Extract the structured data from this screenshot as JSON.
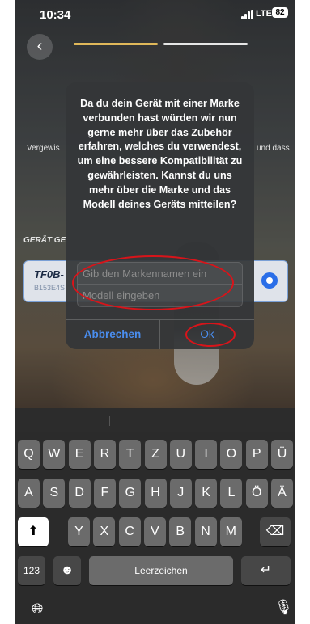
{
  "status_bar": {
    "time": "10:34",
    "network": "LTE",
    "battery": "82"
  },
  "background": {
    "side_text_left": "Vergewis",
    "side_text_right": "und dass",
    "device_section_label": "GERÄT GE",
    "device_name": "TF0B-",
    "device_id": "B153E4S"
  },
  "alert": {
    "message": "Da du dein Gerät mit einer Marke verbunden hast würden wir nun gerne mehr über das Zubehör erfahren, welches du verwendest, um eine bessere Kompatibilität zu gewährleisten. Kannst du uns mehr über die Marke und das Modell deines Geräts mitteilen?",
    "brand_placeholder": "Gib den Markennamen ein",
    "model_placeholder": "Modell eingeben",
    "cancel_label": "Abbrechen",
    "ok_label": "Ok"
  },
  "keyboard": {
    "row1": [
      "Q",
      "W",
      "E",
      "R",
      "T",
      "Z",
      "U",
      "I",
      "O",
      "P",
      "Ü"
    ],
    "row2": [
      "A",
      "S",
      "D",
      "F",
      "G",
      "H",
      "J",
      "K",
      "L",
      "Ö",
      "Ä"
    ],
    "row3": [
      "Y",
      "X",
      "C",
      "V",
      "B",
      "N",
      "M"
    ],
    "numbers_key": "123",
    "space_label": "Leerzeichen"
  },
  "icons": {
    "back": "chevron-left-icon",
    "shift": "shift-icon",
    "delete": "backspace-icon",
    "emoji": "emoji-icon",
    "return": "return-icon",
    "globe": "globe-icon",
    "mic": "microphone-icon"
  },
  "colors": {
    "accent": "#4a8ef0",
    "annotation": "#d8141a",
    "progress": "#e0b85a"
  }
}
